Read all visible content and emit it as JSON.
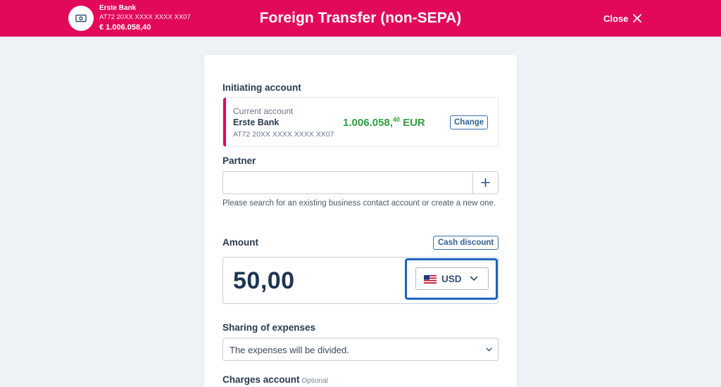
{
  "header": {
    "account_bank": "Erste Bank",
    "account_iban": "AT72 20XX XXXX XXXX XX07",
    "account_balance": "€ 1.006.058,40",
    "title": "Foreign Transfer (non-SEPA)",
    "close_label": "Close",
    "accent_color": "#e2095a"
  },
  "initiating": {
    "label": "Initiating account",
    "account_type": "Current account",
    "account_name": "Erste Bank",
    "account_iban": "AT72 20XX XXXX XXXX XX07",
    "amount_main": "1.006.058,",
    "amount_decimals": "40",
    "amount_currency": "EUR",
    "change_label": "Change"
  },
  "partner": {
    "label": "Partner",
    "input_value": "",
    "hint": "Please search for an existing business contact account or create a new one."
  },
  "amount": {
    "label": "Amount",
    "cash_discount_label": "Cash discount",
    "value": "50,00",
    "currency": "USD",
    "currency_flag": "us-flag-icon"
  },
  "sharing": {
    "label": "Sharing of expenses",
    "selected": "The expenses will be divided."
  },
  "charges": {
    "label": "Charges account",
    "optional": "Optional"
  }
}
